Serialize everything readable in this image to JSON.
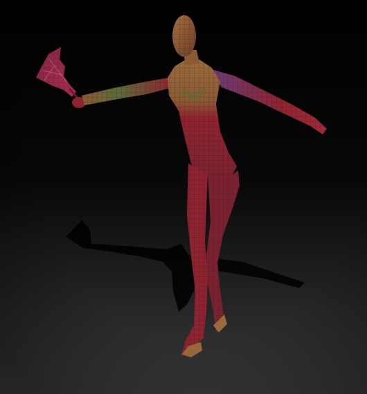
{
  "scene": {
    "subject": "posed-female-mannequin-wireframe",
    "colors": {
      "background_top": "#000000",
      "floor_bottom": "#3a3a3a",
      "mesh_red": "#8e2430",
      "mesh_warm": "#9a6a3c",
      "mesh_purple": "#6a3c78",
      "mesh_line": "#2a1a1a",
      "prop_pink": "#b4325a",
      "shadow": "#000000"
    }
  }
}
